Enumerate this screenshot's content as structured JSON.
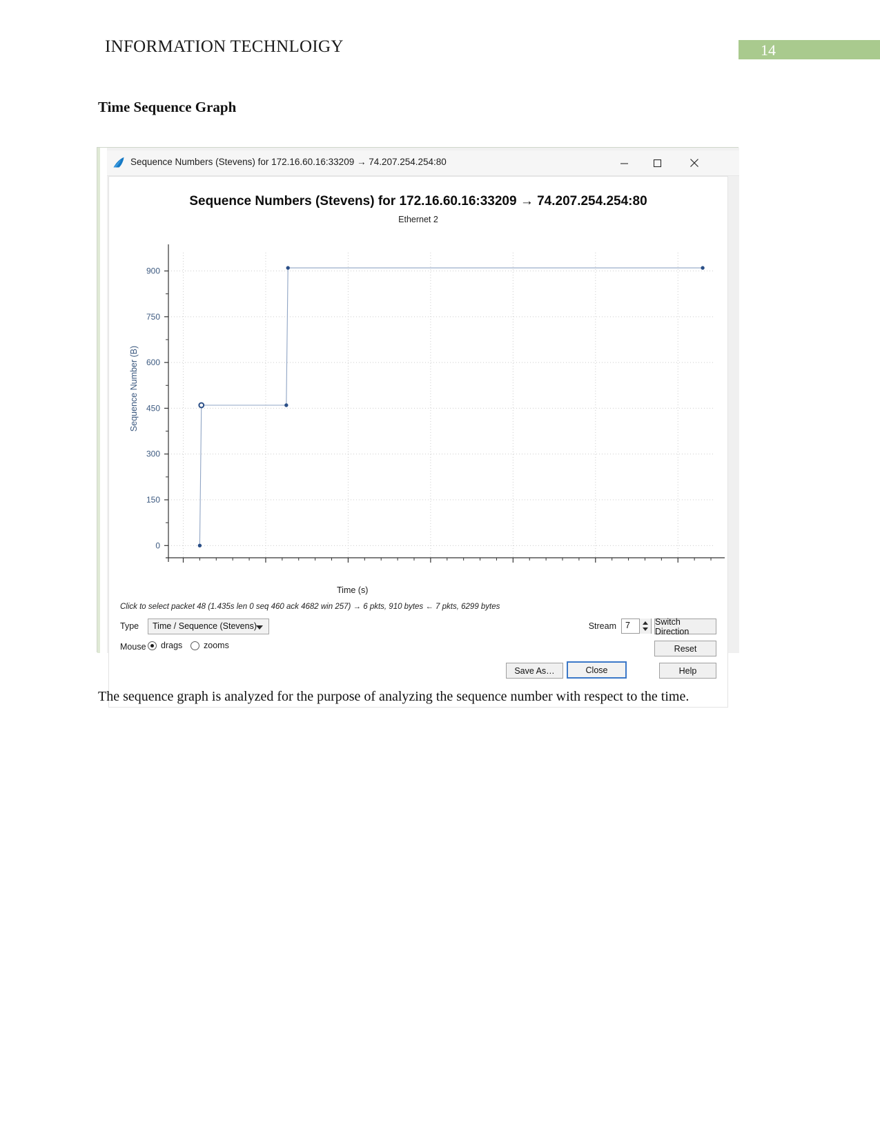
{
  "document": {
    "header_title": "INFORMATION TECHNLOIGY",
    "page_number": "14",
    "page_badge_color": "#a9ca8e",
    "section_heading": "Time Sequence Graph",
    "body_paragraph": "The sequence graph is analyzed for the purpose of analyzing the sequence number with respect to the time."
  },
  "window": {
    "icon": "wireshark-shark-fin-icon",
    "title": "Sequence Numbers (Stevens) for 172.16.60.16:33209 → 74.207.254.254:80",
    "minimize_glyph": "—",
    "maximize_glyph": "☐",
    "close_glyph": "✕"
  },
  "chart_data": {
    "type": "line",
    "title": "Sequence Numbers (Stevens) for 172.16.60.16:33209 → 74.207.254.254:80",
    "subtitle": "Ethernet 2",
    "xlabel": "Time (s)",
    "ylabel": "Sequence Number (B)",
    "xlim": [
      -0.18,
      6.45
    ],
    "ylim": [
      -40,
      960
    ],
    "xticks": [
      "0",
      "1",
      "2",
      "3",
      "4",
      "5",
      "6"
    ],
    "yticks": [
      "0",
      "150",
      "300",
      "450",
      "600",
      "750",
      "900"
    ],
    "grid": true,
    "legend": "none",
    "line_color": "#8fa4c4",
    "marker_color": "#2b4f87",
    "series": [
      {
        "name": "Sequence Numbers (Stevens)",
        "x": [
          0.2,
          0.22,
          1.25,
          1.27,
          6.3
        ],
        "y": [
          0,
          460,
          460,
          910,
          910
        ]
      }
    ],
    "markers": [
      {
        "x": 0.22,
        "y": 460
      },
      {
        "x": 1.25,
        "y": 460
      },
      {
        "x": 1.27,
        "y": 910
      },
      {
        "x": 6.3,
        "y": 910
      },
      {
        "x": 0.2,
        "y": 0
      }
    ]
  },
  "status": {
    "hint": "Click to select packet 48 (1.435s len 0 seq 460 ack 4682 win 257) → 6 pkts, 910 bytes ← 7 pkts, 6299 bytes"
  },
  "controls": {
    "type_label": "Type",
    "type_value": "Time / Sequence (Stevens)",
    "mouse_label": "Mouse",
    "mouse_option_drags": "drags",
    "mouse_option_zooms": "zooms",
    "mouse_selected": "drags",
    "stream_label": "Stream",
    "stream_value": "7",
    "switch_direction_label": "Switch Direction",
    "reset_label": "Reset",
    "save_as_label": "Save As…",
    "close_label": "Close",
    "help_label": "Help"
  }
}
